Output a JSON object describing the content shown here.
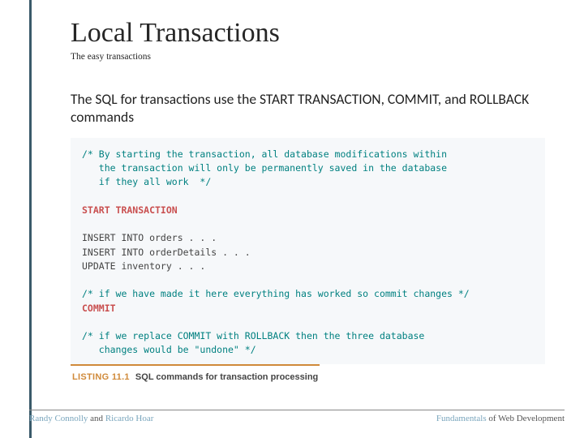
{
  "title": "Local Transactions",
  "subtitle": "The easy transactions",
  "body": "The SQL for transactions use the START TRANSACTION, COMMIT, and ROLLBACK commands",
  "code": {
    "c1a": "/* By starting the transaction, all database modifications within",
    "c1b": "   the transaction will only be permanently saved in the database",
    "c1c": "   if they all work  */",
    "start": "START TRANSACTION",
    "s1": "INSERT INTO orders . . .",
    "s2": "INSERT INTO orderDetails . . .",
    "s3": "UPDATE inventory . . .",
    "c2": "/* if we have made it here everything has worked so commit changes */",
    "commit": "COMMIT",
    "c3a": "/* if we replace COMMIT with ROLLBACK then the three database",
    "c3b": "   changes would be \"undone\" */"
  },
  "listing": {
    "label": "LISTING 11.1",
    "caption": "SQL commands for transaction processing"
  },
  "footer": {
    "left_a": "Randy Connolly",
    "left_mid": " and ",
    "left_b": "Ricardo Hoar",
    "right_a": "Fundamentals",
    "right_b": " of Web Development"
  }
}
